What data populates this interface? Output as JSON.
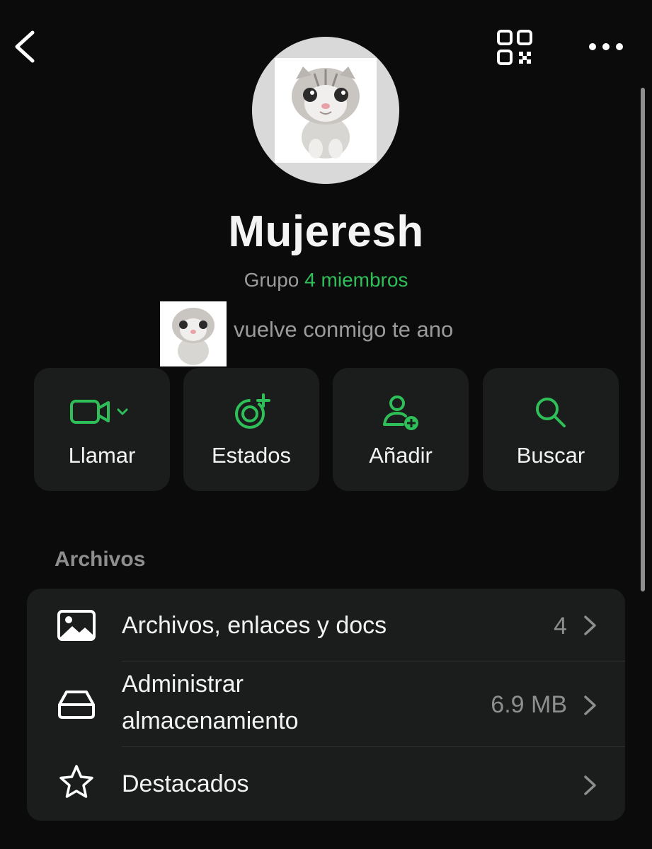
{
  "header": {
    "back_icon": "chevron-left-icon",
    "qr_icon": "qr-code-icon",
    "more_icon": "more-horizontal-icon"
  },
  "group": {
    "name": "Mujeresh",
    "type_label": "Grupo",
    "members_label": "4 miembros",
    "description": "vuelve conmigo te ano"
  },
  "colors": {
    "accent": "#2fbf58",
    "background": "#0b0b0b",
    "card": "#1b1c1c",
    "muted_text": "#9b9b9b"
  },
  "actions": [
    {
      "label": "Llamar",
      "icon": "video-call-icon"
    },
    {
      "label": "Estados",
      "icon": "status-add-icon"
    },
    {
      "label": "Añadir",
      "icon": "add-person-icon"
    },
    {
      "label": "Buscar",
      "icon": "search-icon"
    }
  ],
  "section": {
    "title": "Archivos",
    "rows": [
      {
        "label": "Archivos, enlaces y docs",
        "value": "4",
        "icon": "image-icon"
      },
      {
        "label_line1": "Administrar",
        "label_line2": "almacenamiento",
        "value": "6.9 MB",
        "icon": "storage-icon"
      },
      {
        "label": "Destacados",
        "value": "",
        "icon": "star-icon"
      }
    ]
  }
}
